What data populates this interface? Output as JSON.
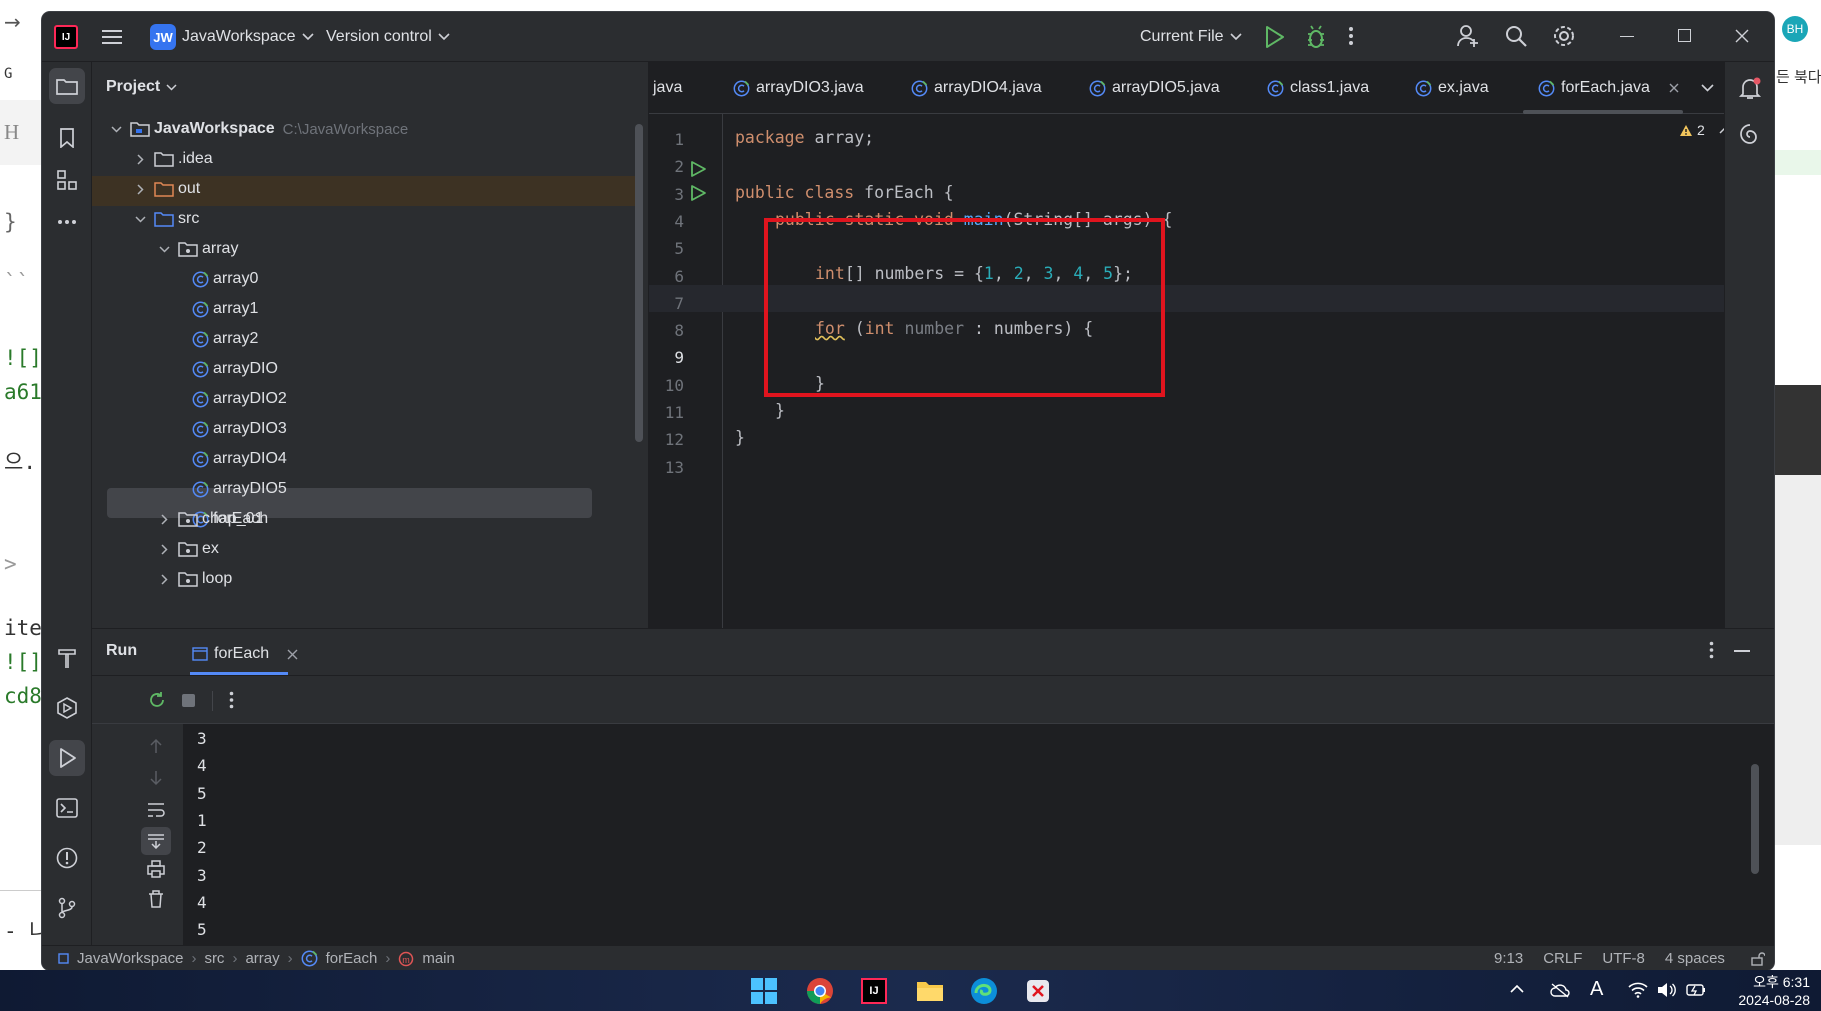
{
  "window": {
    "project_badge": "JW",
    "project_name": "JavaWorkspace",
    "vcs_label": "Version control",
    "run_config": "Current File"
  },
  "project_panel": {
    "title": "Project",
    "root": {
      "name": "JavaWorkspace",
      "path": "C:\\JavaWorkspace"
    },
    "nodes": [
      ".idea",
      "out",
      "src",
      "array",
      "array0",
      "array1",
      "array2",
      "arrayDIO",
      "arrayDIO2",
      "arrayDIO3",
      "arrayDIO4",
      "arrayDIO5",
      "forEach",
      "chap_01",
      "ex",
      "loop"
    ]
  },
  "editor": {
    "tabs": [
      "java",
      "arrayDIO3.java",
      "arrayDIO4.java",
      "arrayDIO5.java",
      "class1.java",
      "ex.java",
      "forEach.java"
    ],
    "active_tab": "forEach.java",
    "warning_count": "2",
    "line_numbers": [
      "1",
      "2",
      "3",
      "4",
      "5",
      "6",
      "7",
      "8",
      "9",
      "10",
      "11",
      "12",
      "13"
    ],
    "code": {
      "l1_kw": "package",
      "l1_rest": " array;",
      "l3_kw1": "public",
      "l3_kw2": "class",
      "l3_rest": " forEach {",
      "l4_kw1": "public",
      "l4_kw2": "static",
      "l4_kw3": "void",
      "l4_fn": "main",
      "l4_rest": "(String[] args) {",
      "l6_kw": "int",
      "l6_a": "[] numbers = {",
      "l6_n1": "1",
      "l6_n2": "2",
      "l6_n3": "3",
      "l6_n4": "4",
      "l6_n5": "5",
      "l6_end": "};",
      "l8_kw1": "for",
      "l8_p": " (",
      "l8_kw2": "int",
      "l8_var": "number",
      "l8_rest": " : numbers) {",
      "l10": "}",
      "l11": "}",
      "l12": "}"
    },
    "highlight_color": "#e0141e"
  },
  "run_panel": {
    "title": "Run",
    "tab": "forEach",
    "output": [
      "3",
      "4",
      "5",
      "1",
      "2",
      "3",
      "4",
      "5"
    ]
  },
  "status_bar": {
    "breadcrumbs": [
      "JavaWorkspace",
      "src",
      "array",
      "forEach",
      "main"
    ],
    "position": "9:13",
    "line_ending": "CRLF",
    "encoding": "UTF-8",
    "indent": "4 spaces"
  },
  "taskbar": {
    "time": "오후 6:31",
    "date": "2024-08-28",
    "lang": "A"
  },
  "background": {
    "left_fragments": [
      "H",
      "}",
      "``",
      "![]",
      "a61",
      "으.",
      ">",
      "ite",
      "![]",
      "cd8",
      "- 나"
    ],
    "right_fragments": [
      "BH",
      "든 북다"
    ]
  },
  "colors": {
    "accent": "#3574f0",
    "run_green": "#5fb865",
    "selection": "#43454a"
  }
}
